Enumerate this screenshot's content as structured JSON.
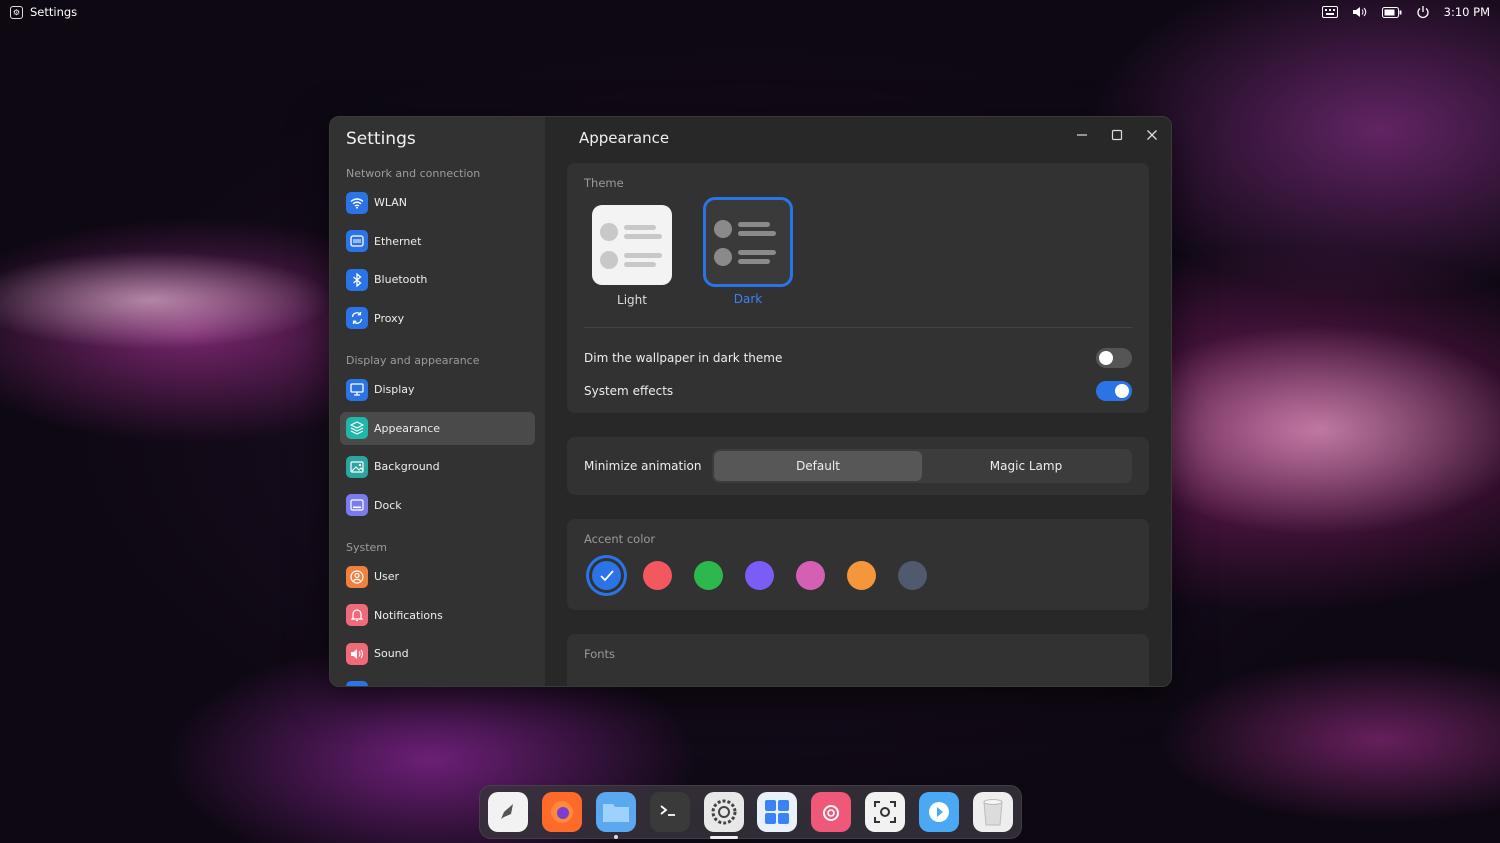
{
  "topbar": {
    "app_name": "Settings",
    "clock": "3:10 PM"
  },
  "sidebar": {
    "title": "Settings",
    "sections": [
      {
        "label": "Network and connection"
      },
      {
        "label": "Display and appearance"
      },
      {
        "label": "System"
      }
    ],
    "items": [
      {
        "label": "WLAN",
        "icon": "wifi-icon",
        "color": "#2b74e8"
      },
      {
        "label": "Ethernet",
        "icon": "ethernet-icon",
        "color": "#2b74e8"
      },
      {
        "label": "Bluetooth",
        "icon": "bluetooth-icon",
        "color": "#2b74e8"
      },
      {
        "label": "Proxy",
        "icon": "proxy-icon",
        "color": "#2b74e8"
      },
      {
        "label": "Display",
        "icon": "display-icon",
        "color": "#2b74e8"
      },
      {
        "label": "Appearance",
        "icon": "appearance-icon",
        "color": "#1fb8a8"
      },
      {
        "label": "Background",
        "icon": "background-icon",
        "color": "#2aa5a0"
      },
      {
        "label": "Dock",
        "icon": "dock-icon",
        "color": "#7b7bf0"
      },
      {
        "label": "User",
        "icon": "user-icon",
        "color": "#f08040"
      },
      {
        "label": "Notifications",
        "icon": "notifications-icon",
        "color": "#f06a7a"
      },
      {
        "label": "Sound",
        "icon": "sound-icon",
        "color": "#f06a7a"
      }
    ]
  },
  "main": {
    "title": "Appearance",
    "theme": {
      "label": "Theme",
      "options": [
        {
          "label": "Light"
        },
        {
          "label": "Dark",
          "selected": true
        }
      ]
    },
    "dim_wallpaper": {
      "label": "Dim the wallpaper in dark theme",
      "on": false
    },
    "system_effects": {
      "label": "System effects",
      "on": true
    },
    "minimize_animation": {
      "label": "Minimize animation",
      "options": [
        "Default",
        "Magic Lamp"
      ],
      "selected": "Default"
    },
    "accent": {
      "label": "Accent color",
      "colors": [
        "#2b74e8",
        "#f2585e",
        "#2db84d",
        "#7b5cf5",
        "#d45fb3",
        "#f5963a",
        "#4f5a6e"
      ],
      "selected_index": 0
    },
    "fonts": {
      "label": "Fonts"
    }
  },
  "dock": {
    "apps": [
      {
        "name": "launcher-icon",
        "color": "#f2f2f2"
      },
      {
        "name": "firefox-icon",
        "color": "#ff6a2b"
      },
      {
        "name": "files-icon",
        "color": "#5aa8f0"
      },
      {
        "name": "terminal-icon",
        "color": "#3a3a3a"
      },
      {
        "name": "settings-icon",
        "color": "#e8e8e8"
      },
      {
        "name": "calculator-icon",
        "color": "#e9f1fb"
      },
      {
        "name": "app-store-icon",
        "color": "#f0587a"
      },
      {
        "name": "screenshot-icon",
        "color": "#f2f2f2"
      },
      {
        "name": "media-player-icon",
        "color": "#4aa8f5"
      },
      {
        "name": "trash-icon",
        "color": "#eeeeee"
      }
    ]
  }
}
